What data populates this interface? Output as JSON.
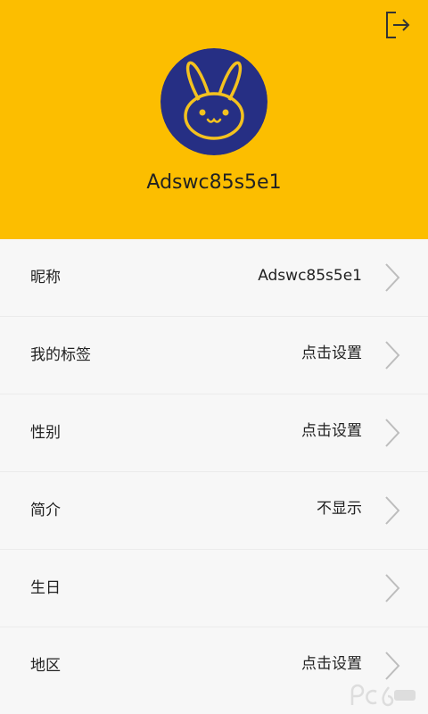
{
  "header": {
    "background_color": "#fcbe00",
    "logout_icon": "logout-icon",
    "avatar_icon": "bunny-avatar-icon",
    "username": "Adswc85s5e1"
  },
  "rows": [
    {
      "label": "昵称",
      "value": "Adswc85s5e1"
    },
    {
      "label": "我的标签",
      "value": "点击设置"
    },
    {
      "label": "性别",
      "value": "点击设置"
    },
    {
      "label": "简介",
      "value": "不显示"
    },
    {
      "label": "生日",
      "value": ""
    },
    {
      "label": "地区",
      "value": "点击设置"
    }
  ],
  "chevron_icon": "chevron-right-icon",
  "watermark_icon": "pc6-logo-watermark"
}
